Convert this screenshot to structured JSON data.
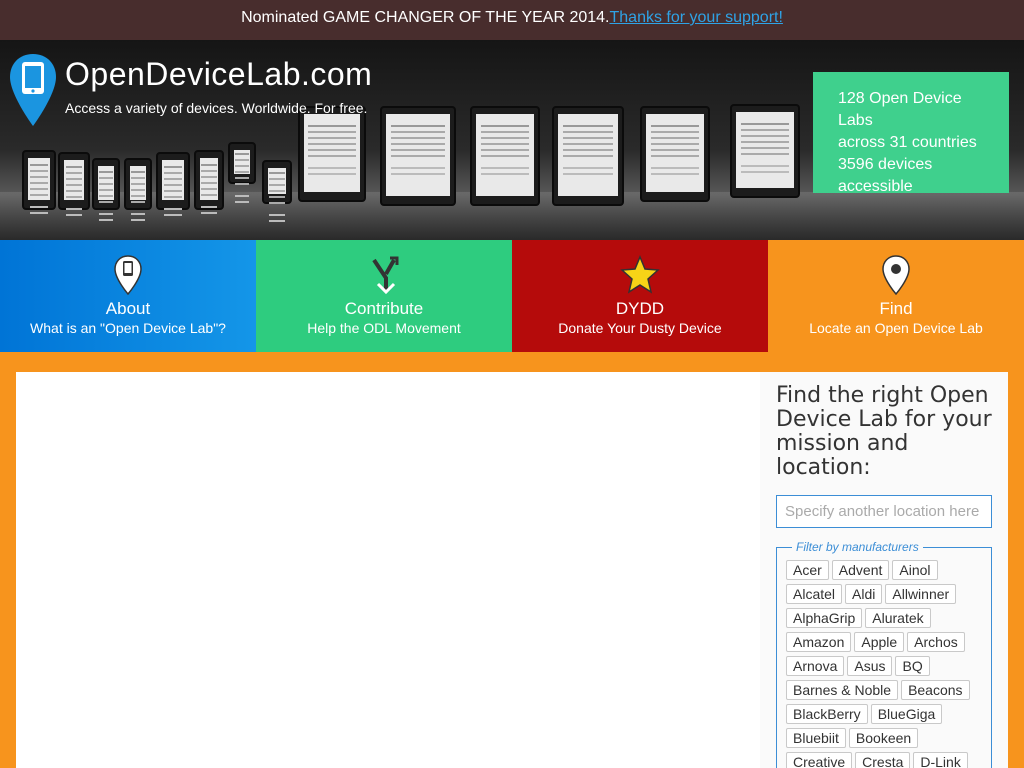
{
  "banner": {
    "text": "Nominated GAME CHANGER OF THE YEAR 2014.",
    "link": "Thanks for your support!"
  },
  "brand": {
    "name": "OpenDeviceLab.com",
    "tagline": "Access a variety of devices. Worldwide. For free."
  },
  "stats": {
    "line1": "128 Open Device Labs",
    "line2": "across 31 countries",
    "line3": "3596 devices",
    "line4": "accessible"
  },
  "nav": [
    {
      "title": "About",
      "sub": "What is an \"Open Device Lab\"?",
      "icon": "device-pin-icon"
    },
    {
      "title": "Contribute",
      "sub": "Help the ODL Movement",
      "icon": "merge-arrows-icon"
    },
    {
      "title": "DYDD",
      "sub": "Donate Your Dusty Device",
      "icon": "star-icon"
    },
    {
      "title": "Find",
      "sub": "Locate an Open Device Lab",
      "icon": "location-pin-icon"
    }
  ],
  "panel": {
    "heading": "Find the right Open Device Lab for your mission and location:",
    "search_placeholder": "Specify another location here",
    "filter_legend": "Filter by manufacturers",
    "manufacturers": [
      "Acer",
      "Advent",
      "Ainol",
      "Alcatel",
      "Aldi",
      "Allwinner",
      "AlphaGrip",
      "Aluratek",
      "Amazon",
      "Apple",
      "Archos",
      "Arnova",
      "Asus",
      "BQ",
      "Barnes & Noble",
      "Beacons",
      "BlackBerry",
      "BlueGiga",
      "Bluebiit",
      "Bookeen",
      "Creative",
      "Cresta",
      "D-Link"
    ]
  },
  "colors": {
    "banner_bg": "#482d2d",
    "about": "#0a84e0",
    "contribute": "#2ecc7f",
    "dydd": "#b50b0b",
    "find": "#f7941d",
    "stats_bg": "#3fd08d"
  }
}
